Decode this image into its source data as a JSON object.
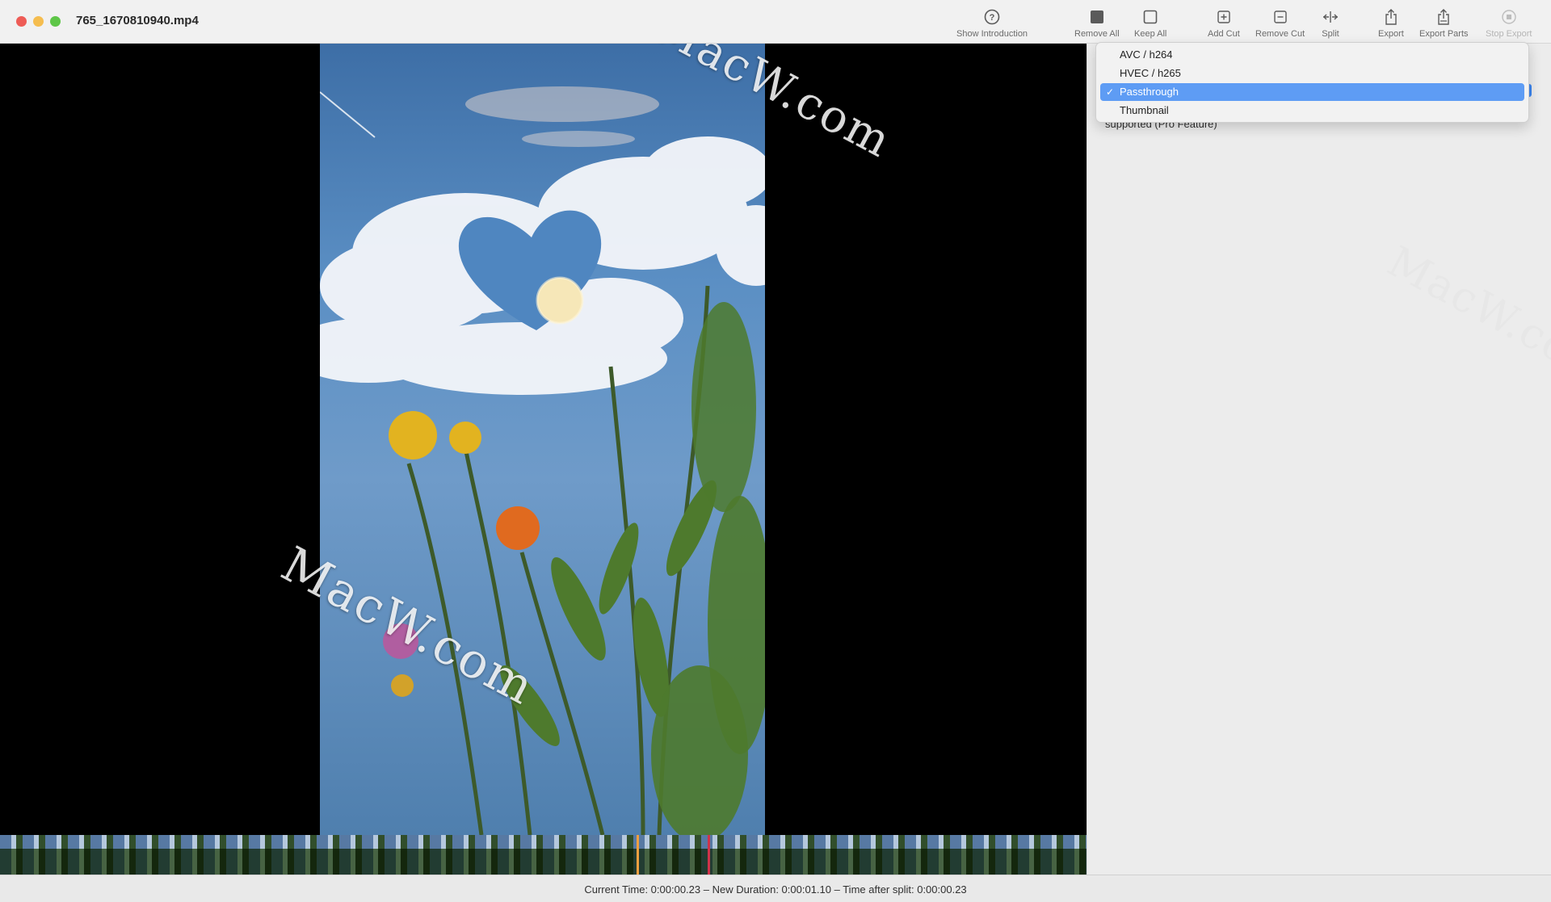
{
  "window": {
    "title": "765_1670810940.mp4"
  },
  "toolbar": {
    "show_introduction": "Show Introduction",
    "remove_all": "Remove All",
    "keep_all": "Keep All",
    "add_cut": "Add Cut",
    "remove_cut": "Remove Cut",
    "split": "Split",
    "export": "Export",
    "export_parts": "Export Parts",
    "stop_export": "Stop Export"
  },
  "export_menu": {
    "items": [
      {
        "label": "AVC / h264",
        "selected": false
      },
      {
        "label": "HVEC / h265",
        "selected": false
      },
      {
        "label": "Passthrough",
        "selected": true
      },
      {
        "label": "Thumbnail",
        "selected": false
      }
    ],
    "check": "✓"
  },
  "side_panel": {
    "note": "supported (Pro Feature)"
  },
  "status": {
    "text": "Current Time: 0:00:00.23 – New Duration: 0:00:01.10 – Time after split: 0:00:00.23"
  },
  "watermark": {
    "text": "MacW.com"
  },
  "colors": {
    "accent": "#5e9cf4",
    "playhead_orange": "#f0a040",
    "playhead_red": "#d0334a"
  }
}
